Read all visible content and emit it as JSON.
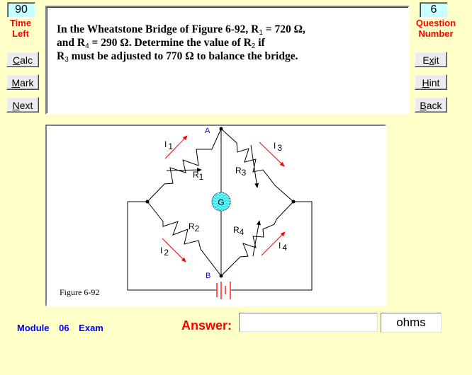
{
  "left_panel": {
    "time_left_value": "90",
    "time_left_label_1": "Time",
    "time_left_label_2": "Left",
    "buttons": [
      {
        "pre": "",
        "u": "C",
        "post": "alc"
      },
      {
        "pre": "",
        "u": "M",
        "post": "ark"
      },
      {
        "pre": "",
        "u": "N",
        "post": "ext"
      }
    ]
  },
  "right_panel": {
    "question_number_value": "6",
    "question_number_label_1": "Question",
    "question_number_label_2": "Number",
    "buttons": [
      {
        "pre": "E",
        "u": "x",
        "post": "it"
      },
      {
        "pre": "",
        "u": "H",
        "post": "int"
      },
      {
        "pre": "",
        "u": "B",
        "post": "ack"
      }
    ]
  },
  "question": {
    "line1_a": "In the Wheatstone Bridge of Figure 6-92,  R",
    "line1_sub": "1",
    "line1_b": " = 720 Ω,",
    "line2_a": "and  R",
    "line2_sub": "4",
    "line2_b": " = 290 Ω.   Determine the value of  R",
    "line2_sub2": "2",
    "line2_c": " if",
    "line3_a": "R",
    "line3_sub": "3",
    "line3_b": " must be adjusted to 770 Ω to balance the bridge."
  },
  "figure": {
    "caption": "Figure  6-92",
    "node_a": "A",
    "node_b": "B",
    "galvanometer": "G",
    "resistors": [
      {
        "name": "R",
        "sub": "1"
      },
      {
        "name": "R",
        "sub": "2"
      },
      {
        "name": "R",
        "sub": "3"
      },
      {
        "name": "R",
        "sub": "4"
      }
    ],
    "currents": [
      {
        "name": "I",
        "sub": "1"
      },
      {
        "name": "I",
        "sub": "2"
      },
      {
        "name": "I",
        "sub": "3"
      },
      {
        "name": "I",
        "sub": "4"
      }
    ],
    "colors": {
      "wire": "#000000",
      "arrow": "#ff0000",
      "node_label": "#0000ff",
      "galvanometer_fill": "#33e6f0",
      "battery": "#ff0000"
    }
  },
  "footer": {
    "module_label": "Module  06  Exam",
    "answer_label": "Answer:",
    "answer_value": "",
    "units": "ohms"
  }
}
